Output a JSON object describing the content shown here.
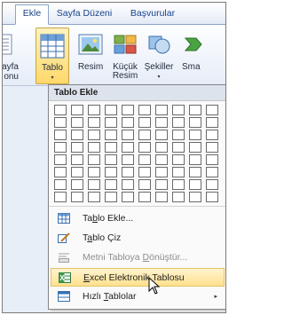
{
  "tabs": [
    {
      "label": "Ekle",
      "active": true
    },
    {
      "label": "Sayfa Düzeni",
      "active": false
    },
    {
      "label": "Başvurular",
      "active": false
    }
  ],
  "ribbon": {
    "cut_left_label": [
      "ayfa",
      "onu"
    ],
    "buttons": [
      {
        "name": "tablo",
        "label": "Tablo",
        "dropdown": "▾",
        "icon": "table-icon"
      },
      {
        "name": "resim",
        "label": "Resim",
        "icon": "picture-icon"
      },
      {
        "name": "kucuk-resim",
        "label": "Küçük",
        "label2": "Resim",
        "icon": "clipart-icon"
      },
      {
        "name": "sekiller",
        "label": "Şekiller",
        "dropdown": "▾",
        "icon": "shapes-icon"
      },
      {
        "name": "smartart",
        "label": "Sma",
        "icon": "smartart-icon"
      }
    ]
  },
  "menu": {
    "header": "Tablo Ekle",
    "grid": {
      "cols": 10,
      "rows": 8
    },
    "items": [
      {
        "pre": "Ta",
        "key": "b",
        "post": "lo Ekle...",
        "icon": "insert-table-icon",
        "disabled": false,
        "highlighted": false
      },
      {
        "pre": "T",
        "key": "a",
        "post": "blo Çiz",
        "icon": "draw-table-icon",
        "disabled": false,
        "highlighted": false
      },
      {
        "pre": "Metni Tabloya ",
        "key": "D",
        "post": "önüştür...",
        "icon": "text-to-table-icon",
        "disabled": true,
        "highlighted": false
      },
      {
        "pre": "",
        "key": "E",
        "post": "xcel Elektronik Tablosu",
        "icon": "excel-sheet-icon",
        "disabled": false,
        "highlighted": true
      },
      {
        "pre": "Hızlı ",
        "key": "T",
        "post": "ablolar",
        "icon": "quick-tables-icon",
        "disabled": false,
        "highlighted": false,
        "submenu": "▸"
      }
    ]
  },
  "colors": {
    "accent_highlight": "#ffe08d",
    "ribbon_text": "#15428b"
  }
}
